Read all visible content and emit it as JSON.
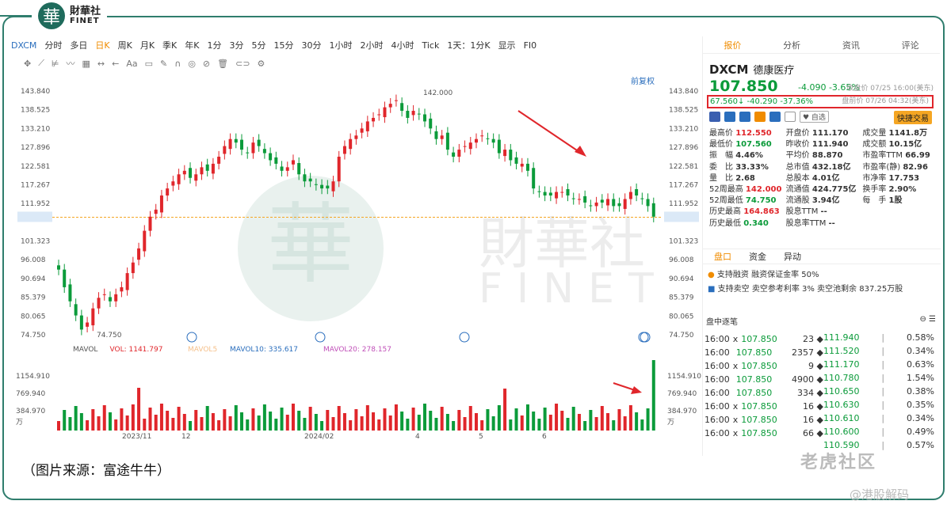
{
  "brand": {
    "mark": "華",
    "cn": "財華社",
    "en": "FINET"
  },
  "toolbar": [
    "DXCM",
    "分时",
    "多日",
    "日K",
    "周K",
    "月K",
    "季K",
    "年K",
    "1分",
    "3分",
    "5分",
    "15分",
    "30分",
    "1小时",
    "2小时",
    "4小时",
    "Tick",
    "1天：1分K",
    "显示",
    "FI0"
  ],
  "toolbar_active": "日K",
  "toolbar2": [
    "Aa"
  ],
  "restore": "前复权",
  "chart_data": {
    "type": "candlestick",
    "y_ticks": [
      "143.840",
      "138.525",
      "133.210",
      "127.896",
      "122.581",
      "117.267",
      "111.952",
      "107.850",
      "101.323",
      "96.008",
      "90.694",
      "85.379",
      "80.065",
      "74.750"
    ],
    "max_label": "142.000",
    "min_label": "74.750",
    "last_price": "107.850",
    "closes": [
      93,
      88,
      84,
      80,
      76,
      78,
      82,
      85,
      86,
      84,
      86,
      88,
      92,
      95,
      99,
      104,
      108,
      110,
      114,
      116,
      118,
      120,
      121,
      119,
      120,
      122,
      121,
      123,
      125,
      128,
      130,
      129,
      127,
      126,
      129,
      128,
      126,
      124,
      123,
      121,
      122,
      124,
      120,
      118,
      118,
      117,
      116,
      116,
      118,
      125,
      128,
      130,
      131,
      133,
      135,
      136,
      137,
      139,
      140,
      141,
      138,
      136,
      138,
      137,
      135,
      133,
      130,
      131,
      127,
      125,
      127,
      128,
      129,
      130,
      131,
      130,
      129,
      126,
      127,
      124,
      123,
      123,
      121,
      116,
      115,
      114,
      114,
      115,
      115,
      114,
      113,
      113,
      112,
      111,
      112,
      112,
      113,
      111,
      111,
      113,
      115,
      114,
      113,
      111,
      108
    ],
    "vol_ticks": [
      "1154.910",
      "769.940",
      "384.970",
      "万"
    ],
    "x_labels": [
      "2023/11",
      "12",
      "2024/02",
      "4",
      "5",
      "6"
    ],
    "vol_legend": {
      "name": "MAVOL",
      "vol": "VOL: 1141.797",
      "mavol5": "MAVOL5",
      "mavol10": "MAVOL10: 335.617",
      "mavol20": "MAVOL20: 278.157"
    }
  },
  "quote": {
    "tabs": [
      "报价",
      "分析",
      "资讯",
      "评论"
    ],
    "code": "DXCM",
    "name": "德康医疗",
    "price": "107.850",
    "change": "-4.090  -3.65%",
    "close_note": "收盘价 07/25 16:00(美东)",
    "pre": "67.560↓  -40.290  -37.36%",
    "pre_time": "盘前价 07/26 04:32(美东)",
    "fav": "♥ 自选",
    "quick": "快捷交易",
    "stats": [
      [
        "最高价",
        "112.550",
        "开盘价",
        "111.170",
        "成交量",
        "1141.8万"
      ],
      [
        "最低价",
        "107.560",
        "昨收价",
        "111.940",
        "成交额",
        "10.15亿"
      ],
      [
        "振　幅",
        "4.46%",
        "平均价",
        "88.870",
        "市盈率TTM",
        "66.99"
      ],
      [
        "委　比",
        "33.33%",
        "总市值",
        "432.18亿",
        "市盈率(静)",
        "82.96"
      ],
      [
        "量　比",
        "2.68",
        "总股本",
        "4.01亿",
        "市净率",
        "17.753"
      ],
      [
        "52周最高",
        "142.000",
        "流通值",
        "424.775亿",
        "换手率",
        "2.90%"
      ],
      [
        "52周最低",
        "74.750",
        "流通股",
        "3.94亿",
        "每　手",
        "1股"
      ],
      [
        "历史最高",
        "164.863",
        "股息TTM",
        "--",
        "",
        ""
      ],
      [
        "历史最低",
        "0.340",
        "股息率TTM",
        "--",
        "",
        ""
      ]
    ],
    "sec_tabs": [
      "盘口",
      "资金",
      "异动"
    ],
    "notes": [
      "支持融资  融资保证金率 50%",
      "支持卖空  卖空参考利率 3%  卖空池剩余 837.25万股"
    ],
    "ticks_title": "盘中逐笔",
    "ticks": [
      [
        "16:00",
        "x",
        "107.850",
        "23"
      ],
      [
        "16:00",
        "",
        "107.850",
        "2357"
      ],
      [
        "16:00",
        "x",
        "107.850",
        "9"
      ],
      [
        "16:00",
        "",
        "107.850",
        "4900"
      ],
      [
        "16:00",
        "",
        "107.850",
        "334"
      ],
      [
        "16:00",
        "x",
        "107.850",
        "16"
      ],
      [
        "16:00",
        "x",
        "107.850",
        "16"
      ],
      [
        "16:00",
        "x",
        "107.850",
        "66"
      ]
    ],
    "book": [
      [
        "111.940",
        "0.58%"
      ],
      [
        "111.520",
        "0.34%"
      ],
      [
        "111.170",
        "0.63%"
      ],
      [
        "110.780",
        "1.54%"
      ],
      [
        "110.650",
        "0.38%"
      ],
      [
        "110.630",
        "0.35%"
      ],
      [
        "110.610",
        "0.34%"
      ],
      [
        "110.600",
        "0.49%"
      ],
      [
        "110.590",
        "0.57%"
      ]
    ]
  },
  "caption": "（图片来源：富途牛牛）",
  "watermark": "老虎社区",
  "watermark2": "@港股解码"
}
